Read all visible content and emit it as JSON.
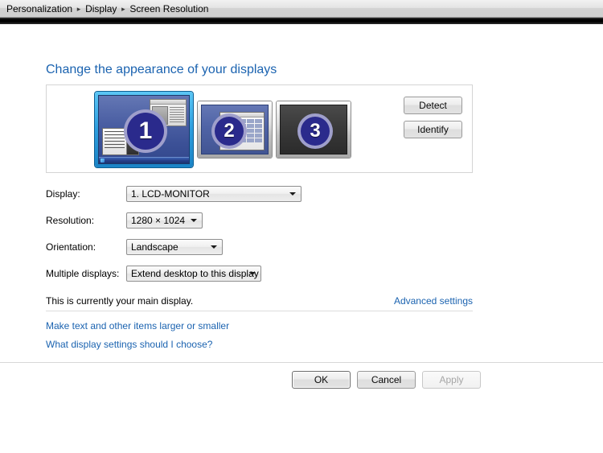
{
  "breadcrumb": {
    "items": [
      "Personalization",
      "Display",
      "Screen Resolution"
    ],
    "separator": "▸"
  },
  "page": {
    "title": "Change the appearance of your displays"
  },
  "preview": {
    "monitors": [
      {
        "number": "1",
        "name": "monitor-1",
        "state": "selected-main"
      },
      {
        "number": "2",
        "name": "monitor-2",
        "state": "extended"
      },
      {
        "number": "3",
        "name": "monitor-3",
        "state": "inactive"
      }
    ],
    "detect_label": "Detect",
    "identify_label": "Identify"
  },
  "form": {
    "display": {
      "label": "Display:",
      "value": "1. LCD-MONITOR"
    },
    "resolution": {
      "label": "Resolution:",
      "value": "1280 × 1024"
    },
    "orientation": {
      "label": "Orientation:",
      "value": "Landscape"
    },
    "multiple_displays": {
      "label": "Multiple displays:",
      "value": "Extend desktop to this display"
    }
  },
  "status": {
    "text": "This is currently your main display.",
    "advanced_settings": "Advanced settings"
  },
  "links": {
    "make_text_larger": "Make text and other items larger or smaller",
    "what_settings": "What display settings should I choose?"
  },
  "footer": {
    "ok": "OK",
    "cancel": "Cancel",
    "apply": "Apply"
  },
  "colors": {
    "link": "#1b63b0",
    "title": "#1b63b0",
    "selection_glow": "#2d9ede",
    "badge": "#2a2a8c"
  }
}
